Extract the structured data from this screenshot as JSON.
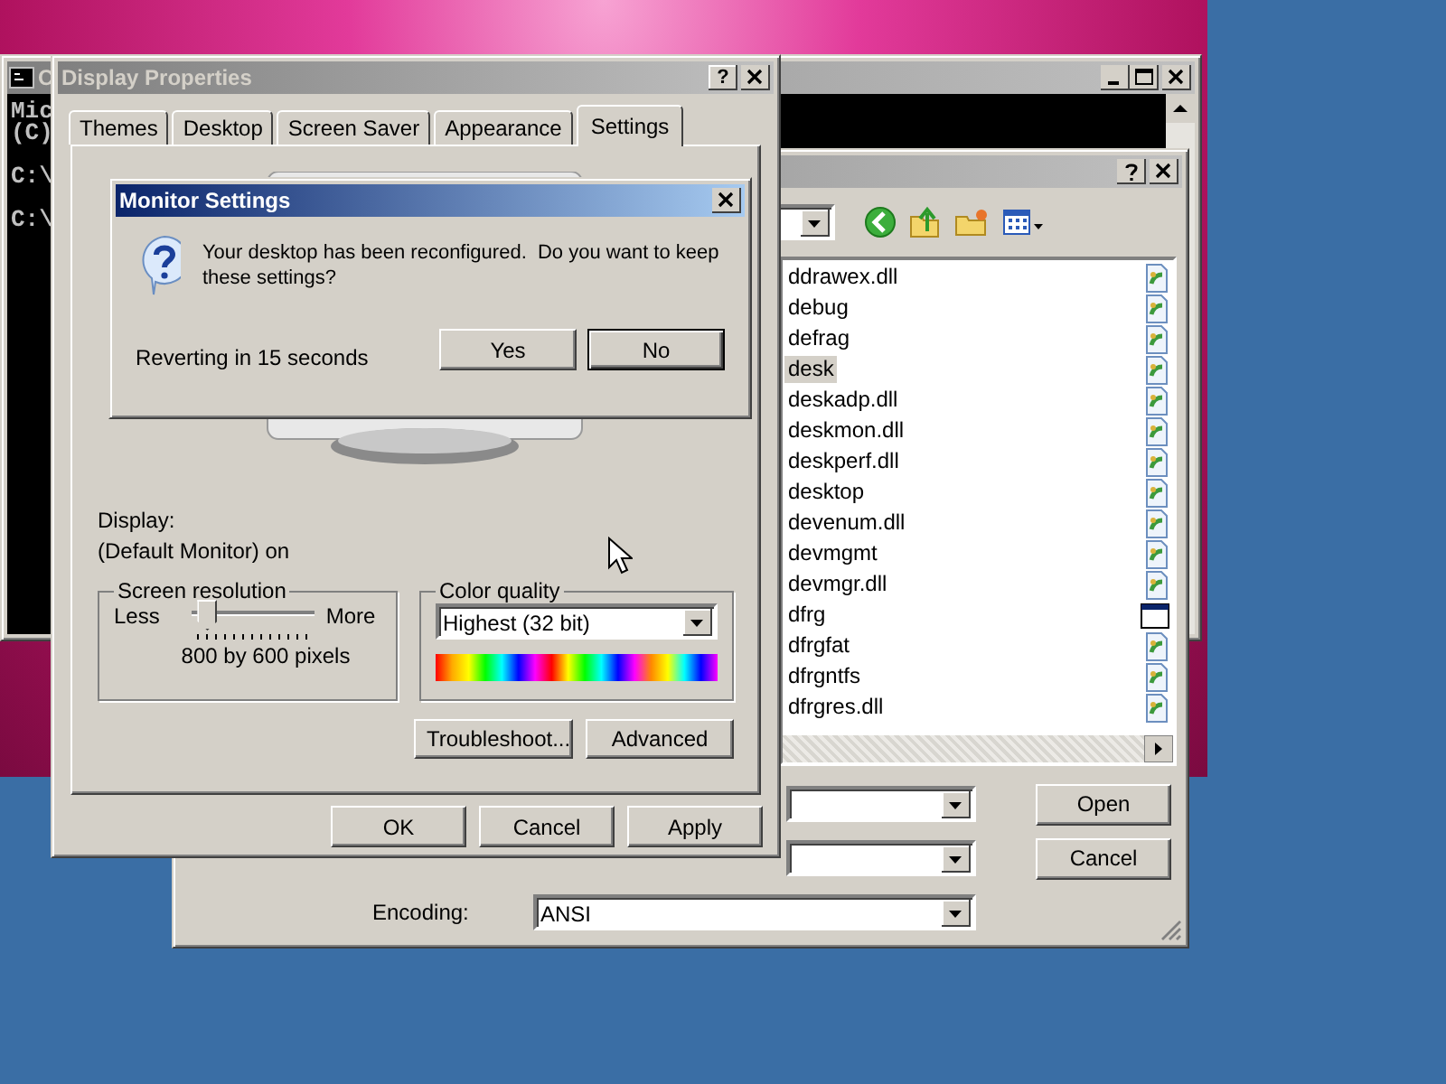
{
  "console_window": {
    "title": "C",
    "blocks": [
      {
        "lines": [
          "Mic",
          "(C)"
        ]
      },
      {
        "lines": [
          "C:\\"
        ]
      },
      {
        "lines": [
          "C:\\"
        ]
      }
    ]
  },
  "open_dialog": {
    "file_list": [
      {
        "name": "ddrawex.dll",
        "kind": "document",
        "selected": false
      },
      {
        "name": "debug",
        "kind": "document",
        "selected": false
      },
      {
        "name": "defrag",
        "kind": "document",
        "selected": false
      },
      {
        "name": "desk",
        "kind": "document",
        "selected": true
      },
      {
        "name": "deskadp.dll",
        "kind": "document",
        "selected": false
      },
      {
        "name": "deskmon.dll",
        "kind": "document",
        "selected": false
      },
      {
        "name": "deskperf.dll",
        "kind": "document",
        "selected": false
      },
      {
        "name": "desktop",
        "kind": "document",
        "selected": false
      },
      {
        "name": "devenum.dll",
        "kind": "document",
        "selected": false
      },
      {
        "name": "devmgmt",
        "kind": "document",
        "selected": false
      },
      {
        "name": "devmgr.dll",
        "kind": "document",
        "selected": false
      },
      {
        "name": "dfrg",
        "kind": "window",
        "selected": false
      },
      {
        "name": "dfrgfat",
        "kind": "document",
        "selected": false
      },
      {
        "name": "dfrgntfs",
        "kind": "document",
        "selected": false
      },
      {
        "name": "dfrgres.dll",
        "kind": "document",
        "selected": false
      }
    ],
    "encoding_label": "Encoding:",
    "encoding_value": "ANSI",
    "buttons": [
      "Open",
      "Cancel"
    ]
  },
  "display_properties": {
    "title": "Display Properties",
    "help_label": "?",
    "tabs": [
      {
        "label": "Themes",
        "selected": false
      },
      {
        "label": "Desktop",
        "selected": false
      },
      {
        "label": "Screen Saver",
        "selected": false
      },
      {
        "label": "Appearance",
        "selected": false
      },
      {
        "label": "Settings",
        "selected": true
      }
    ],
    "display_label": "Display:",
    "display_value": "(Default Monitor) on",
    "resolution": {
      "title": "Screen resolution",
      "less": "Less",
      "more": "More",
      "level": 0.05,
      "reading": "800 by 600 pixels"
    },
    "color_quality": {
      "title": "Color quality",
      "value": "Highest (32 bit)"
    },
    "panel_buttons": [
      "Troubleshoot...",
      "Advanced"
    ],
    "buttons": [
      "OK",
      "Cancel",
      "Apply"
    ]
  },
  "monitor_settings": {
    "title": "Monitor Settings",
    "message": "Your desktop has been reconfigured.  Do you want to keep these settings?",
    "countdown": "Reverting in 15 seconds",
    "buttons": [
      {
        "label": "Yes",
        "default": false
      },
      {
        "label": "No",
        "default": true
      }
    ]
  }
}
